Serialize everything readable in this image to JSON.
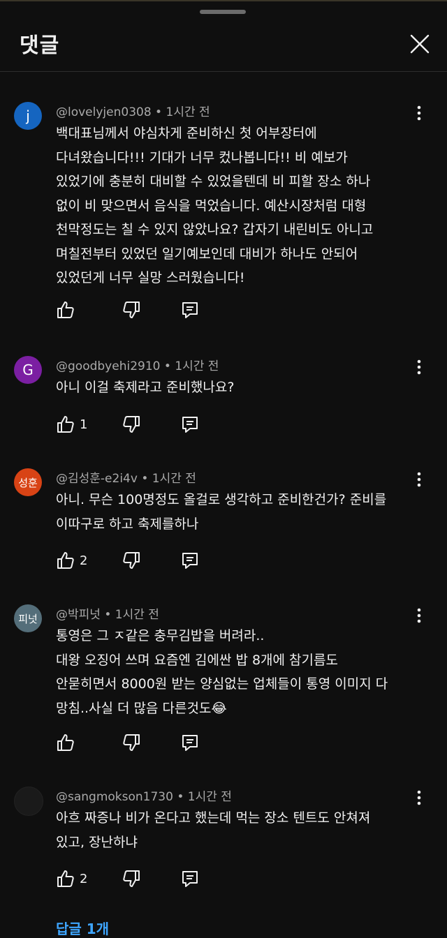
{
  "header": {
    "title": "댓글"
  },
  "comments": [
    {
      "avatar_letter": "j",
      "avatar_color": "#1565c0",
      "author": "@lovelyjen0308",
      "time": "1시간 전",
      "text": "백대표님께서 야심차게 준비하신 첫 어부장터에\n다녀왔습니다!!! 기대가 너무 컸나봅니다!! 비 예보가\n있었기에 충분히 대비할 수 있었을텐데 비 피할 장소 하나\n없이 비 맞으면서 음식을 먹었습니다.  예산시장처럼 대형\n천막정도는 칠 수 있지 않았나요? 갑자기 내린비도 아니고\n며칠전부터 있었던 일기예보인데 대비가 하나도 안되어\n있었던게 너무 실망 스러웠습니다!",
      "likes": ""
    },
    {
      "avatar_letter": "G",
      "avatar_color": "#7b1fa2",
      "author": "@goodbyehi2910",
      "time": "1시간 전",
      "text": "아니 이걸 축제라고 준비했나요?",
      "likes": "1"
    },
    {
      "avatar_letter": "성훈",
      "avatar_color": "#d84315",
      "author": "@김성훈-e2i4v",
      "time": "1시간 전",
      "text": "아니. 무슨 100명정도 올걸로 생각하고 준비한건가? 준비를\n이따구로 하고 축제를하나",
      "likes": "2"
    },
    {
      "avatar_letter": "피넛",
      "avatar_color": "#546e7a",
      "author": "@박피넛",
      "time": "1시간 전",
      "text": "통영은 그 ㅈ같은 충무김밥을 버려라..\n대왕 오징어 쓰며 요즘엔 김에싼 밥 8개에 참기름도\n안묻히면서 8000원 받는 양심없는 업체들이 통영 이미지 다\n망침..사실 더 많음 다른것도😂",
      "likes": ""
    },
    {
      "avatar_letter": "",
      "avatar_color": "#1a1a1a",
      "author": "@sangmokson1730",
      "time": "1시간 전",
      "text": "아흐 짜증나 비가 온다고 했는데 먹는 장소 텐트도 안쳐져\n있고, 장난하냐",
      "likes": "2"
    }
  ],
  "replies_link": "답글 1개"
}
